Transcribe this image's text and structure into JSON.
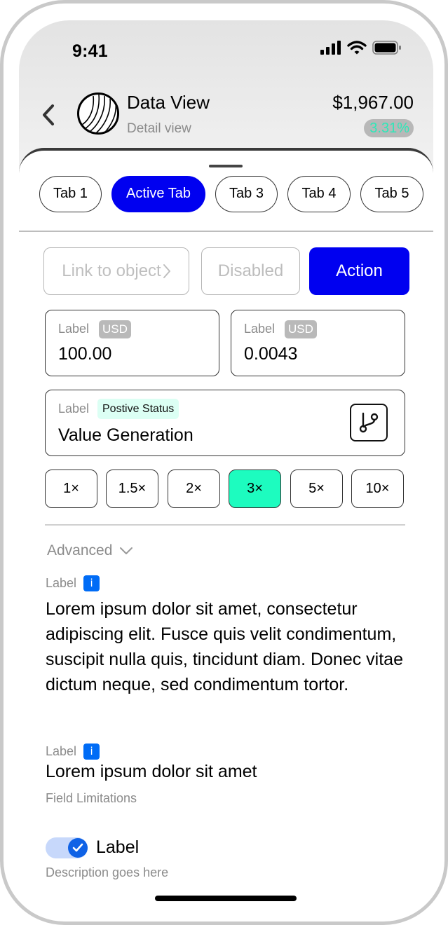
{
  "status_bar": {
    "time": "9:41",
    "icons": [
      "cellular-signal-icon",
      "wifi-icon",
      "battery-icon"
    ]
  },
  "header": {
    "title": "Data View",
    "subtitle": "Detail view",
    "price": "$1,967.00",
    "change": "3.31%",
    "change_color": "#2ee8b8",
    "icons": [
      "back-chevron-icon",
      "wave-logo-icon"
    ]
  },
  "tabs": [
    {
      "label": "Tab 1",
      "active": false
    },
    {
      "label": "Active Tab",
      "active": true
    },
    {
      "label": "Tab 3",
      "active": false
    },
    {
      "label": "Tab 4",
      "active": false
    },
    {
      "label": "Tab 5",
      "active": false
    }
  ],
  "actions": {
    "link_label": "Link to object",
    "disabled_label": "Disabled",
    "action_label": "Action",
    "accent_color": "#0000f0"
  },
  "fields": {
    "amount_1": {
      "label": "Label",
      "badge": "USD",
      "value": "100.00"
    },
    "amount_2": {
      "label": "Label",
      "badge": "USD",
      "value": "0.0043"
    },
    "status_field": {
      "label": "Label",
      "badge": "Postive Status",
      "value": "Value Generation",
      "icon": "branch-icon"
    }
  },
  "multipliers": {
    "options": [
      "1×",
      "1.5×",
      "2×",
      "3×",
      "5×",
      "10×"
    ],
    "selected": "3×",
    "selected_color": "#1dfcbf"
  },
  "advanced": {
    "label": "Advanced"
  },
  "section1": {
    "label": "Label",
    "info": "i",
    "text": "Lorem ipsum dolor sit amet, consectetur adipiscing elit. Fusce quis velit condimentum, suscipit nulla quis, tincidunt diam. Donec vitae dictum neque, sed condimentum tortor."
  },
  "section2": {
    "label": "Label",
    "info": "i",
    "text": "Lorem ipsum dolor sit amet",
    "helper": "Field Limitations"
  },
  "toggle": {
    "label": "Label",
    "description": "Description goes here",
    "checked": true
  }
}
